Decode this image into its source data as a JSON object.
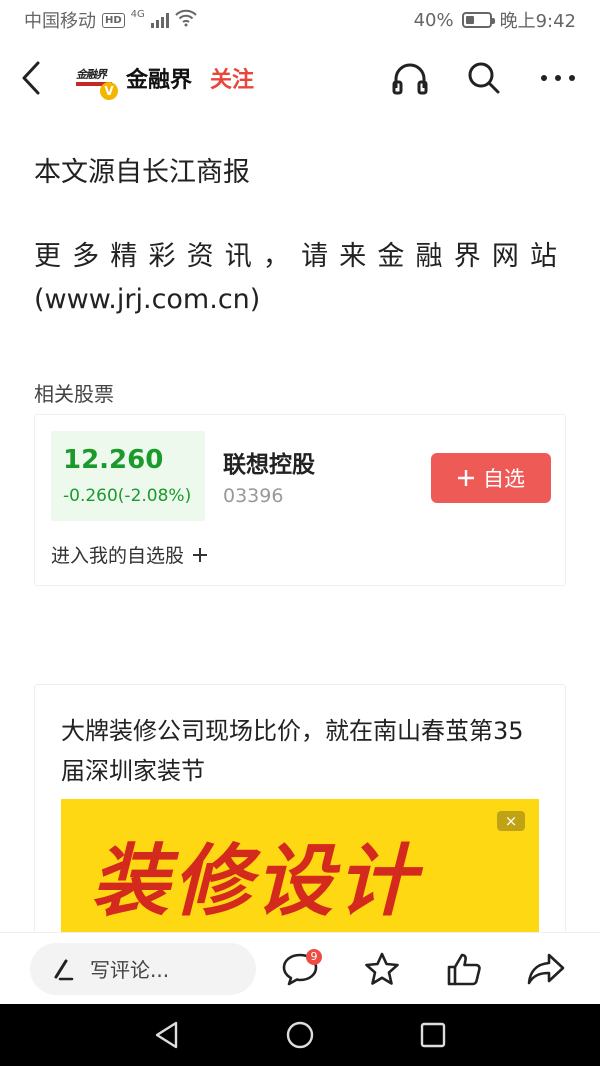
{
  "status_bar": {
    "carrier": "中国移动",
    "network_badge": "HD",
    "network_type": "4G",
    "battery_percent": "40%",
    "battery_level": 0.4,
    "time": "晚上9:42"
  },
  "header": {
    "logo_text": "金融界",
    "brand_name": "金融界",
    "follow_label": "关注",
    "icons": [
      "back-icon",
      "headphones-icon",
      "search-icon",
      "more-icon"
    ]
  },
  "article": {
    "source": "本文源自长江商报",
    "more_line1": "更多精彩资讯，请来金融界网站",
    "more_line2": "(www.jrj.com.cn)"
  },
  "related": {
    "label": "相关股票",
    "stock": {
      "price": "12.260",
      "change": "-0.260(-2.08%)",
      "name": "联想控股",
      "code": "03396",
      "add_label": "自选",
      "enter_link": "进入我的自选股"
    }
  },
  "ad": {
    "title": "大牌装修公司现场比价，就在南山春茧第35届深圳家装节",
    "image_text": "装修设计",
    "close_label": "×"
  },
  "action_bar": {
    "comment_placeholder": "写评论...",
    "comment_count": "9",
    "icons": [
      "pen-icon",
      "comment-icon",
      "star-icon",
      "thumbs-up-icon",
      "share-icon"
    ]
  },
  "colors": {
    "accent_red": "#ee5a56",
    "follow_red": "#e8453c",
    "stock_green": "#1b9a2c",
    "ad_yellow": "#ffd814"
  }
}
